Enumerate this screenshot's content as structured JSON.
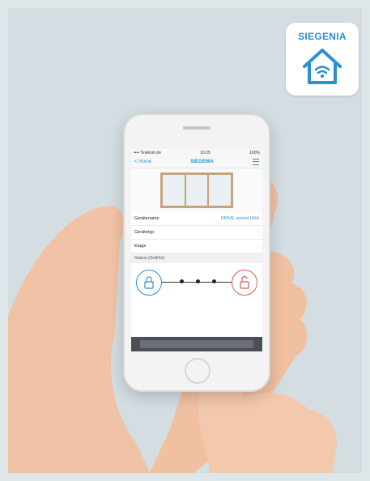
{
  "badge": {
    "brand": "SIEGENIA",
    "icon": "smart-home-wifi-icon",
    "brand_color": "#2b8fd0"
  },
  "phone": {
    "status": {
      "carrier": "•••• Telekom.de",
      "time": "10:25",
      "battery": "100%"
    },
    "nav": {
      "back": "< Home",
      "title": "SIEGENIA",
      "menu_icon": "menu-icon"
    },
    "rows": [
      {
        "label": "Gerätename",
        "value": "DRIVE axxent HSA"
      },
      {
        "label": "Gerätetyp",
        "value": ""
      },
      {
        "label": "Etage",
        "value": ""
      }
    ],
    "section": "Status (Soll/Ist)"
  }
}
